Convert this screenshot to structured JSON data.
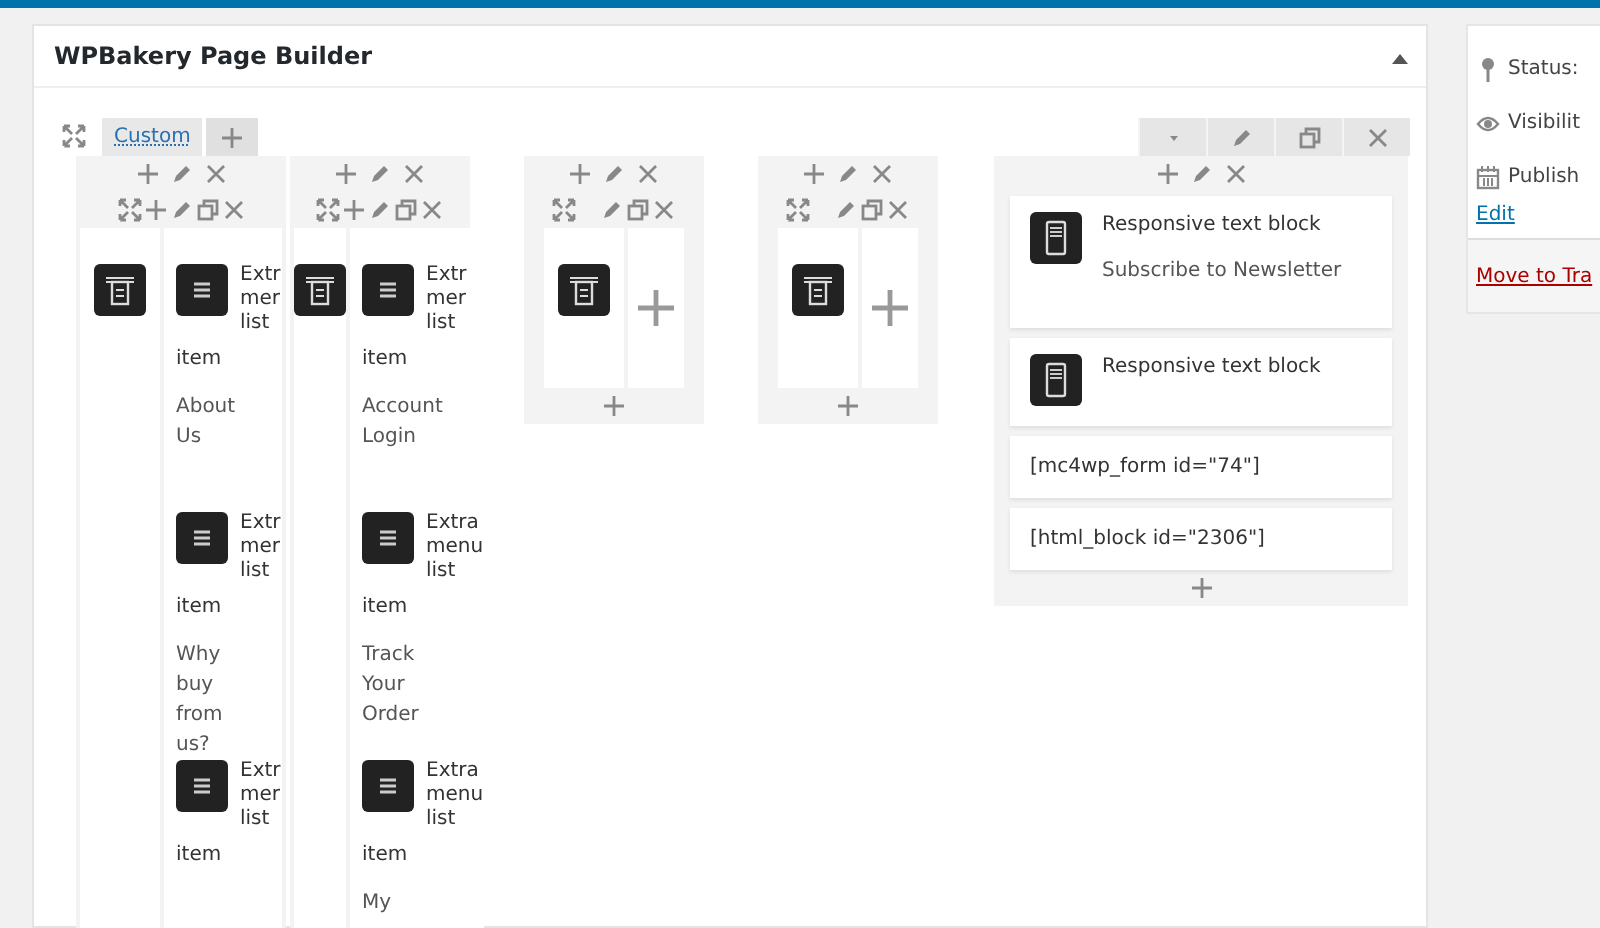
{
  "panel": {
    "title": "WPBakery Page Builder"
  },
  "row_tabs": [
    {
      "label": "Custom",
      "selected": true
    }
  ],
  "columns": [
    {
      "kind": "nested_list",
      "inner": [
        {
          "elements": [
            {
              "kind": "widget"
            }
          ]
        },
        {
          "elements": [
            {
              "kind": "menu",
              "title": "Extr mer list",
              "title_end": "item",
              "text": "About Us"
            },
            {
              "kind": "menu",
              "title": "Extr mer list",
              "title_end": "item",
              "text": "Why buy from us?"
            },
            {
              "kind": "menu",
              "title": "Extr mer list",
              "title_end": "item"
            }
          ]
        }
      ]
    },
    {
      "kind": "nested_list",
      "inner": [
        {
          "elements": [
            {
              "kind": "widget"
            }
          ]
        },
        {
          "elements": [
            {
              "kind": "menu",
              "title": "Extr mer list",
              "title_end": "item",
              "text": "Account Login"
            },
            {
              "kind": "menu",
              "title": "Extra menu list",
              "title_end": "item",
              "text": "Track Your Order"
            },
            {
              "kind": "menu",
              "title": "Extra menu list",
              "title_end": "item",
              "text": "My"
            }
          ]
        }
      ]
    },
    {
      "kind": "nested_box",
      "inner": [
        {
          "elements": [
            {
              "kind": "widget"
            }
          ]
        },
        {
          "kind": "empty"
        }
      ]
    },
    {
      "kind": "nested_box",
      "inner": [
        {
          "elements": [
            {
              "kind": "widget"
            }
          ]
        },
        {
          "kind": "empty"
        }
      ]
    },
    {
      "kind": "simple",
      "elements": [
        {
          "kind": "text_block",
          "title": "Responsive text block",
          "text": "Subscribe to Newsletter"
        },
        {
          "kind": "text_block",
          "title": "Responsive text block"
        },
        {
          "kind": "shortcode",
          "text": "[mc4wp_form id=\"74\"]"
        },
        {
          "kind": "shortcode",
          "text": "[html_block id=\"2306\"]"
        }
      ]
    }
  ],
  "sidebar": {
    "rows": [
      {
        "kind": "pin",
        "label": "Status:"
      },
      {
        "kind": "eye",
        "label": "Visibilit"
      },
      {
        "kind": "calendar",
        "label": "Publish"
      }
    ],
    "edit_link": "Edit",
    "trash_link": "Move to Tra"
  }
}
